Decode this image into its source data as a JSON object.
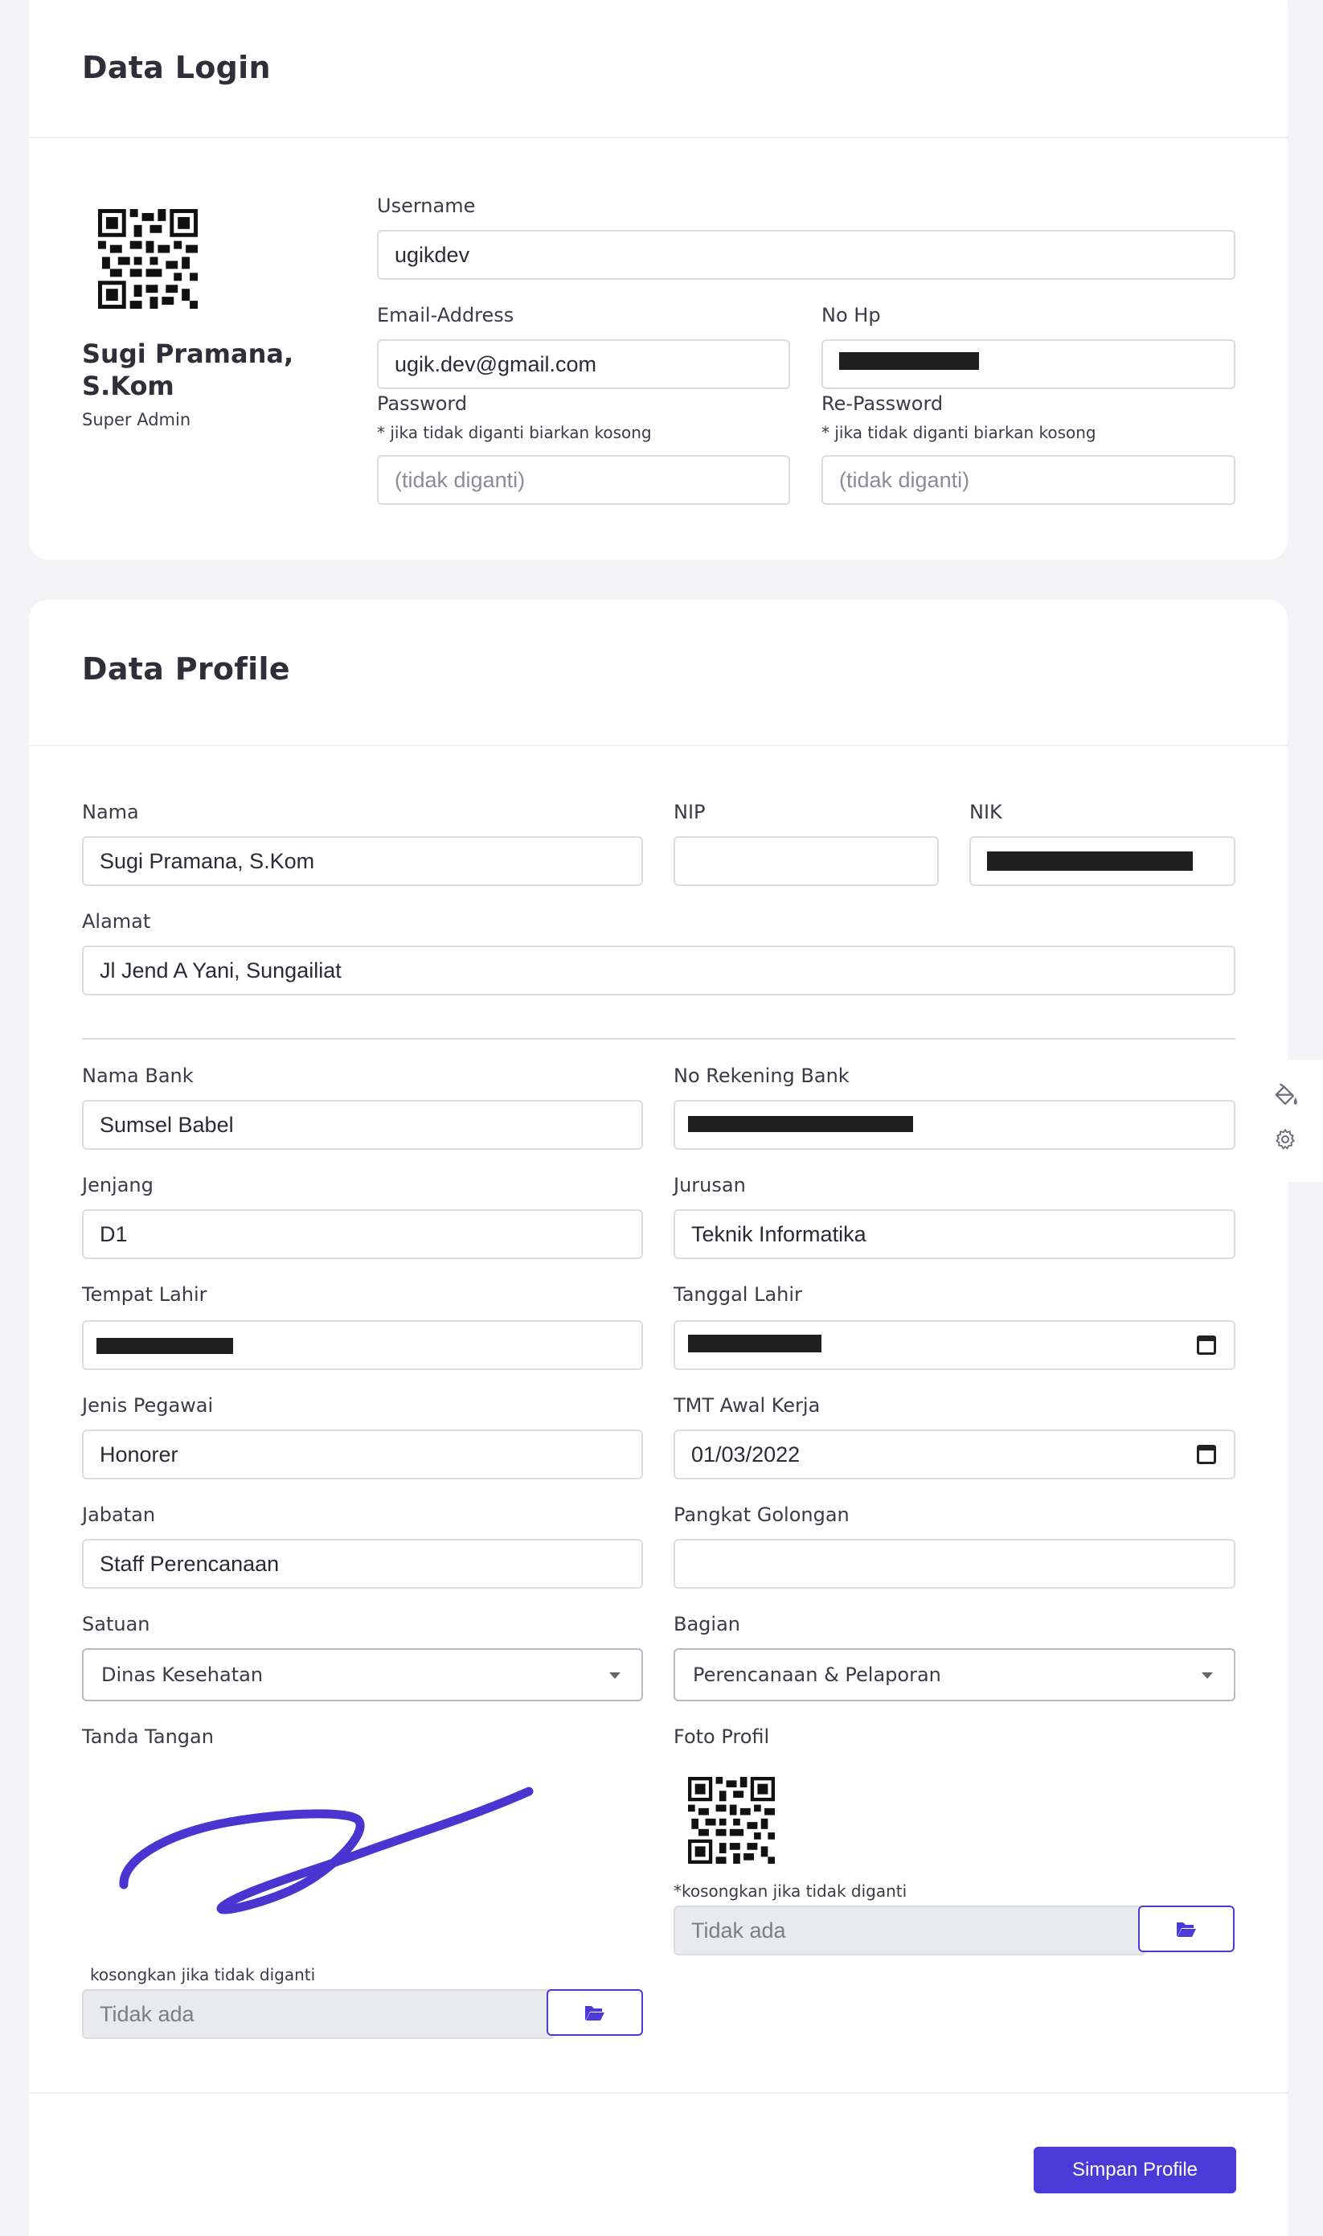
{
  "login_card": {
    "title": "Data Login",
    "user": {
      "name_line1": "Sugi Pramana,",
      "name_line2": "S.Kom",
      "role": "Super Admin"
    },
    "username": {
      "label": "Username",
      "value": "ugikdev"
    },
    "email": {
      "label": "Email-Address",
      "value": "ugik.dev@gmail.com"
    },
    "phone": {
      "label": "No Hp",
      "value": ""
    },
    "password": {
      "label": "Password",
      "hint": "* jika tidak diganti biarkan kosong",
      "placeholder": "(tidak diganti)"
    },
    "repassword": {
      "label": "Re-Password",
      "hint": "* jika tidak diganti biarkan kosong",
      "placeholder": "(tidak diganti)"
    }
  },
  "profile_card": {
    "title": "Data Profile",
    "nama": {
      "label": "Nama",
      "value": "Sugi Pramana, S.Kom"
    },
    "nip": {
      "label": "NIP",
      "value": ""
    },
    "nik": {
      "label": "NIK",
      "value": ""
    },
    "alamat": {
      "label": "Alamat",
      "value": "Jl Jend A Yani, Sungailiat"
    },
    "nama_bank": {
      "label": "Nama Bank",
      "value": "Sumsel Babel"
    },
    "no_rekening": {
      "label": "No Rekening Bank",
      "value": ""
    },
    "jenjang": {
      "label": "Jenjang",
      "value": "D1"
    },
    "jurusan": {
      "label": "Jurusan",
      "value": "Teknik Informatika"
    },
    "tempat_lahir": {
      "label": "Tempat Lahir",
      "value": ""
    },
    "tanggal_lahir": {
      "label": "Tanggal Lahir",
      "value": ""
    },
    "jenis_pegawai": {
      "label": "Jenis Pegawai",
      "value": "Honorer"
    },
    "tmt_awal": {
      "label": "TMT Awal Kerja",
      "value": "01/03/2022"
    },
    "jabatan": {
      "label": "Jabatan",
      "value": "Staff Perencanaan"
    },
    "pangkat": {
      "label": "Pangkat Golongan",
      "value": ""
    },
    "satuan": {
      "label": "Satuan",
      "value": "Dinas Kesehatan"
    },
    "bagian": {
      "label": "Bagian",
      "value": "Perencanaan & Pelaporan"
    },
    "tanda_tangan": {
      "label": "Tanda Tangan",
      "hint": "kosongkan jika tidak diganti",
      "file_value": "Tidak ada"
    },
    "foto_profil": {
      "label": "Foto Profil",
      "hint": "*kosongkan jika tidak diganti",
      "file_value": "Tidak ada"
    },
    "submit_label": "Simpan Profile"
  },
  "colors": {
    "accent": "#4a3ad8",
    "signature": "#4a35d0",
    "background": "#f4f4f6"
  },
  "icons": {
    "qr": "qr-code-icon",
    "folder": "folder-open-icon",
    "paint": "paint-bucket-icon",
    "gear": "gear-icon",
    "calendar": "calendar-icon"
  }
}
